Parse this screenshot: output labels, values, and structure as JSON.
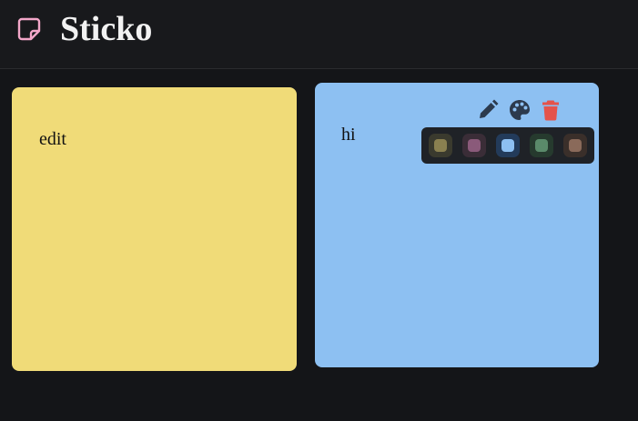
{
  "app": {
    "title": "Sticko",
    "logo_icon": "sticky-note-icon",
    "logo_color": "#f3a7c9"
  },
  "notes": [
    {
      "text": "edit",
      "color": "#f0db78"
    },
    {
      "text": "hi",
      "color": "#8dc0f2",
      "toolbar": {
        "icons": [
          "pencil-icon",
          "palette-icon",
          "trash-icon"
        ],
        "delete_color": "#e5534b",
        "icon_color": "#2c3a4d"
      },
      "palette": {
        "selected": "blue",
        "swatches": [
          {
            "name": "yellow",
            "color": "#8a8050",
            "ring": "#3a3a2e"
          },
          {
            "name": "pink",
            "color": "#8a5a7a",
            "ring": "#3a2d37"
          },
          {
            "name": "blue",
            "color": "#8dc0f2",
            "ring": "#233b5a"
          },
          {
            "name": "green",
            "color": "#5a8a6a",
            "ring": "#263a2e"
          },
          {
            "name": "brown",
            "color": "#8a6a5a",
            "ring": "#3a2f2a"
          }
        ]
      }
    }
  ]
}
